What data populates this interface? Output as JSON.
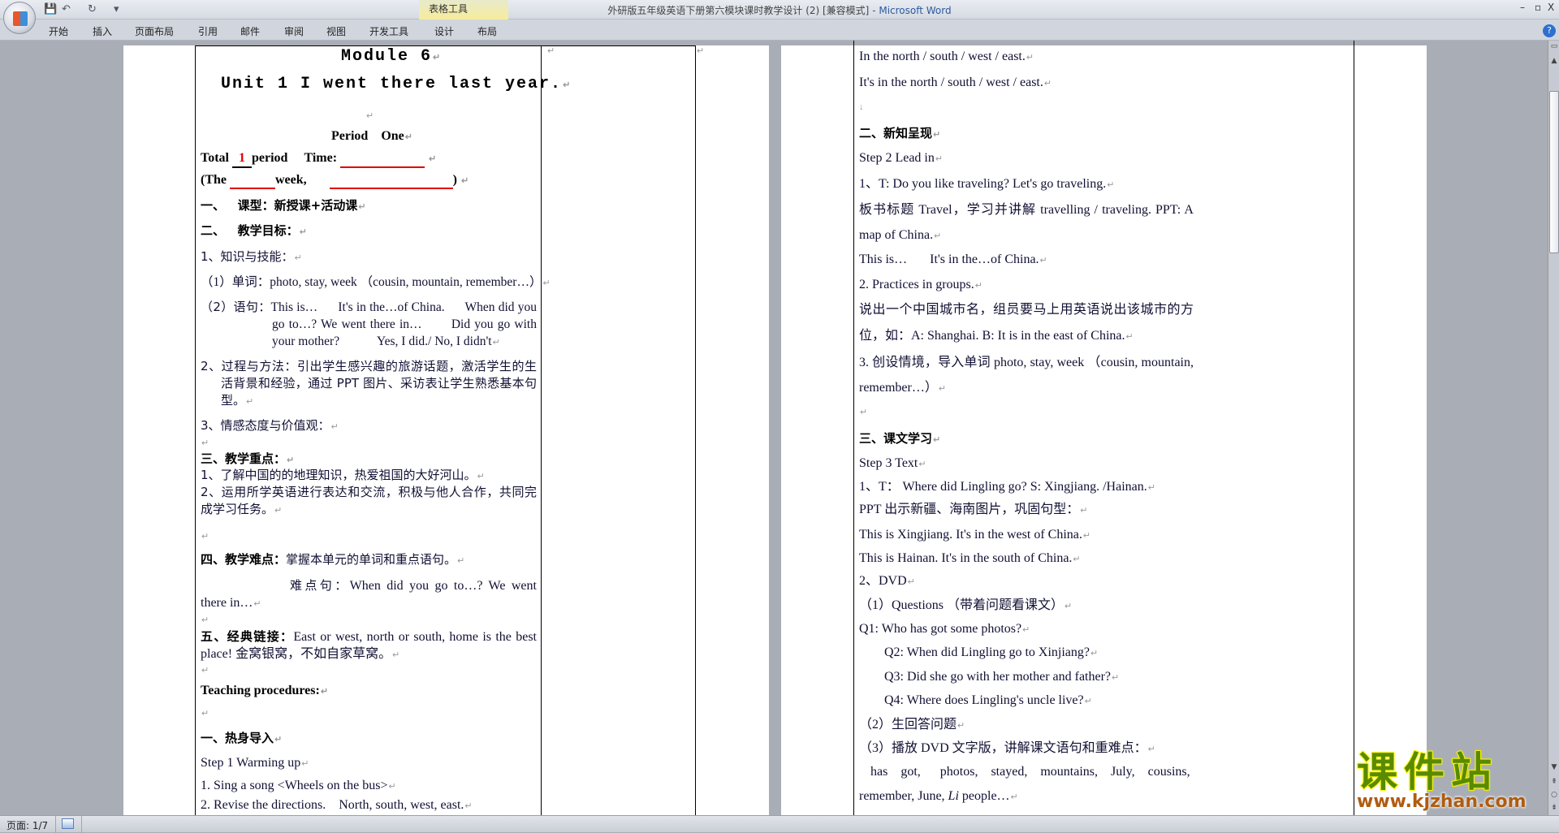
{
  "window": {
    "title": "外研版五年级英语下册第六模块课时教学设计 (2) [兼容模式]",
    "app": " - Microsoft Word",
    "minimize": "–",
    "restore": "▫",
    "close": "X"
  },
  "quick_access": {
    "save_icon": "save-icon",
    "undo_icon": "undo-icon",
    "redo_icon": "redo-icon",
    "customize": "▾"
  },
  "contextual_tab_group": "表格工具",
  "ribbon_tabs": [
    "开始",
    "插入",
    "页面布局",
    "引用",
    "邮件",
    "审阅",
    "视图",
    "开发工具",
    "设计",
    "布局"
  ],
  "help": "?",
  "left_page": {
    "module": "Module 6",
    "unit": "Unit 1 I went there last year.",
    "period": "Period    One",
    "total_label": "Total",
    "total_value": "1",
    "period_label": "period",
    "time_label": "Time:",
    "the_label": "(The",
    "week_label": "week,",
    "close_paren": ")",
    "s1": "一、   课型：新授课+活动课",
    "s2": "二、   教学目标：",
    "k1": "1、知识与技能：",
    "k1a": "（1）单词：photo, stay, week （cousin, mountain, remember…）",
    "k1b_head": "（2）语句：",
    "k1b": "This is…      It's in the…of China.      When did you go to…? We went there in…       Did you go with your mother?            Yes, I did./ No, I didn't",
    "k2": "2、过程与方法：引出学生感兴趣的旅游话题，激活学生的生活背景和经验，通过 PPT 图片、采访表让学生熟悉基本句型。",
    "k3": "3、情感态度与价值观：",
    "s3": "三、教学重点：",
    "f1": "1、了解中国的的地理知识，热爱祖国的大好河山。",
    "f2": "2、运用所学英语进行表达和交流，积极与他人合作，共同完成学习任务。",
    "s4_head": "四、教学难点：",
    "s4": "掌握本单元的单词和重点语句。",
    "d_head": "难点句：",
    "d": "When did you go to…? We went there in…",
    "s5_head": "五、经典链接：",
    "s5": "East or west, north or south, home is the best place! 金窝银窝，不如自家草窝。",
    "procedures": "Teaching procedures:",
    "warm": "一、热身导入",
    "step1": "Step 1 Warming  up",
    "sing": "1. Sing a song <Wheels on the bus>",
    "revise": "2. Revise the directions.    North, south, west, east."
  },
  "right_page": {
    "l1": "In the north / south / west / east.",
    "l2": "It's in the north / south / west / east.",
    "l3": "↓",
    "h2": "二、新知呈现",
    "step2": "Step 2 Lead in",
    "t1": "1、T: Do you like traveling? Let's go traveling.",
    "t2": "板书标题 Travel，学习并讲解 travelling  /  traveling.  PPT:  A map of China.",
    "t3": "This is…       It's in the…of China.",
    "t4": "2. Practices in groups.",
    "t5": "说出一个中国城市名，组员要马上用英语说出该城市的方位，如：A: Shanghai.    B: It is in the east of China.",
    "t6": "3. 创设情境，导入单词 photo, stay, week （cousin, mountain, remember…）",
    "h3": "三、课文学习",
    "step3": "Step 3 Text",
    "x1": "1、T： Where did Lingling go? S: Xingjiang. /Hainan.",
    "x2": "PPT 出示新疆、海南图片，巩固句型：",
    "x3": "This is Xingjiang. It's in the west of China.",
    "x4": "This is Hainan. It's in the south of China.",
    "x5": "2、DVD",
    "x6": "（1）Questions （带着问题看课文）",
    "q1": "Q1: Who has got some photos?",
    "q2": "Q2: When did Lingling go to Xinjiang?",
    "q3": "Q3: Did she go with her mother and father?",
    "q4": "Q4: Where does Lingling's uncle live?",
    "x7": "（2）生回答问题",
    "x8": "（3）播放 DVD 文字版，讲解课文语句和重难点：",
    "x9": "has  got,   photos,  stayed,  mountains,  July,  cousins,",
    "x10a": "remember, June, ",
    "x10b": "Li",
    "x10c": " people…"
  },
  "statusbar": {
    "page": "页面: 1/7"
  },
  "watermark": {
    "name": "课件站",
    "url": "www.kjzhan.com"
  },
  "colors": {
    "accent_red": "#e00000",
    "watermark_green": "#5a8a00",
    "watermark_brown": "#b05c10"
  }
}
